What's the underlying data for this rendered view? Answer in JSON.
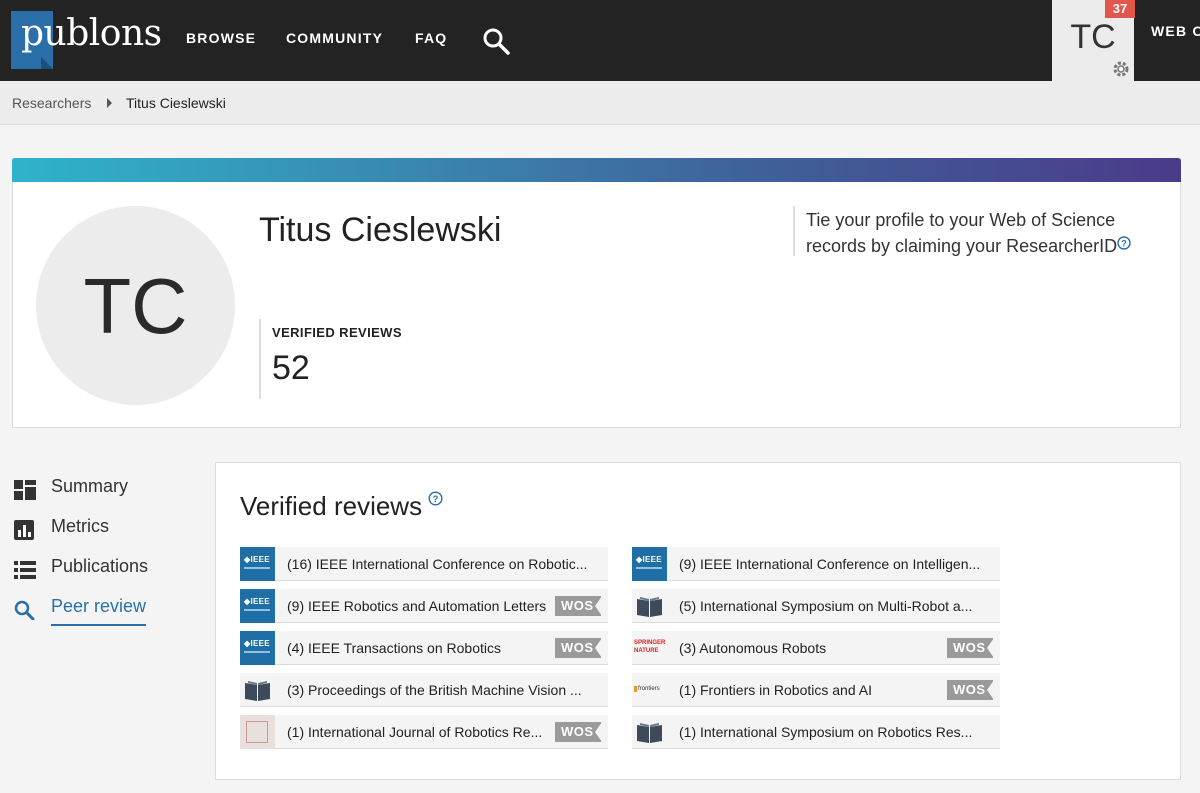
{
  "nav": {
    "logo": "publons",
    "browse": "BROWSE",
    "community": "COMMUNITY",
    "faq": "FAQ",
    "user_initials": "TC",
    "notification_count": "37",
    "wos_link": "WEB OF SCIENCE"
  },
  "breadcrumb": {
    "parent": "Researchers",
    "current": "Titus Cieslewski"
  },
  "profile": {
    "initials": "TC",
    "name": "Titus Cieslewski",
    "stat_label": "VERIFIED REVIEWS",
    "stat_value": "52",
    "tie_text": "Tie your profile to your Web of Science records by claiming your ResearcherID"
  },
  "sidebar": {
    "items": [
      {
        "label": "Summary",
        "icon": "summary-icon"
      },
      {
        "label": "Metrics",
        "icon": "metrics-icon"
      },
      {
        "label": "Publications",
        "icon": "publications-icon"
      },
      {
        "label": "Peer review",
        "icon": "search-icon",
        "active": true
      }
    ]
  },
  "reviews": {
    "title": "Verified reviews",
    "badge_label": "WOS",
    "left": [
      {
        "label": "(16) IEEE International Conference on Robotic...",
        "thumb": "ieee",
        "wos": false
      },
      {
        "label": "(9) IEEE Robotics and Automation Letters",
        "thumb": "ieee",
        "wos": true
      },
      {
        "label": "(4) IEEE Transactions on Robotics",
        "thumb": "ieee",
        "wos": true
      },
      {
        "label": "(3) Proceedings of the British Machine Vision ...",
        "thumb": "book",
        "wos": false
      },
      {
        "label": "(1) International Journal of Robotics Re...",
        "thumb": "journal",
        "wos": true
      }
    ],
    "right": [
      {
        "label": "(9) IEEE International Conference on Intelligen...",
        "thumb": "ieee",
        "wos": false
      },
      {
        "label": "(5) International Symposium on Multi-Robot a...",
        "thumb": "book",
        "wos": false
      },
      {
        "label": "(3) Autonomous Robots",
        "thumb": "springer",
        "wos": true
      },
      {
        "label": "(1) Frontiers in Robotics and AI",
        "thumb": "frontiers",
        "wos": true
      },
      {
        "label": "(1) International Symposium on Robotics Res...",
        "thumb": "book",
        "wos": false
      }
    ]
  },
  "thumbs": {
    "ieee": "◆IEEE",
    "springer_top": "SPRINGER",
    "springer_bottom": "NATURE",
    "frontiers": "frontiers"
  },
  "colors": {
    "topbar": "#232323",
    "accent": "#2a6fa8",
    "notification": "#e2574c",
    "wos_badge": "#9a9a9a"
  }
}
